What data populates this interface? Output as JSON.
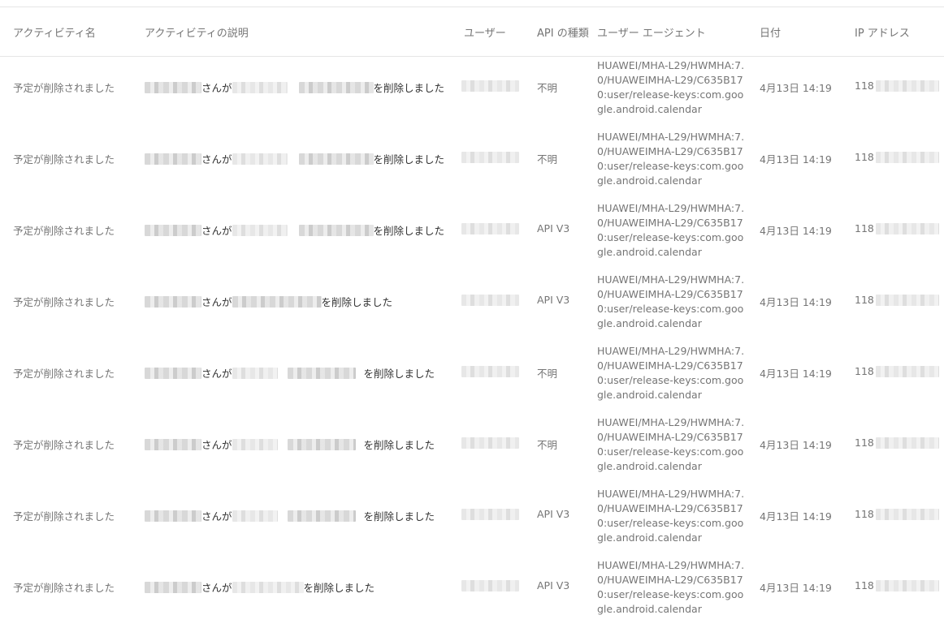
{
  "headers": {
    "activity_name": "アクティビティ名",
    "activity_description": "アクティビティの説明",
    "user": "ユーザー",
    "api_type": "API の種類",
    "user_agent": "ユーザー エージェント",
    "date": "日付",
    "ip_address": "IP アドレス"
  },
  "rows": [
    {
      "activity_name": "予定が削除されました",
      "desc_mid": "さんが",
      "desc_end": "を削除しました",
      "api_type": "不明",
      "user_agent": "HUAWEI/MHA-L29/HWMHA:7.0/HUAWEIMHA-L29/C635B170:user/release-keys:com.google.android.calendar",
      "date": "4月13日 14:19",
      "ip_prefix": "118"
    },
    {
      "activity_name": "予定が削除されました",
      "desc_mid": "さんが",
      "desc_end": "を削除しました",
      "api_type": "不明",
      "user_agent": "HUAWEI/MHA-L29/HWMHA:7.0/HUAWEIMHA-L29/C635B170:user/release-keys:com.google.android.calendar",
      "date": "4月13日 14:19",
      "ip_prefix": "118"
    },
    {
      "activity_name": "予定が削除されました",
      "desc_mid": "さんが",
      "desc_end": "を削除しました",
      "api_type": "API V3",
      "user_agent": "HUAWEI/MHA-L29/HWMHA:7.0/HUAWEIMHA-L29/C635B170:user/release-keys:com.google.android.calendar",
      "date": "4月13日 14:19",
      "ip_prefix": "118"
    },
    {
      "activity_name": "予定が削除されました",
      "desc_mid": "さんが",
      "desc_end": "を削除しました",
      "api_type": "API V3",
      "user_agent": "HUAWEI/MHA-L29/HWMHA:7.0/HUAWEIMHA-L29/C635B170:user/release-keys:com.google.android.calendar",
      "date": "4月13日 14:19",
      "ip_prefix": "118"
    },
    {
      "activity_name": "予定が削除されました",
      "desc_mid": "さんが",
      "desc_end": "を削除しました",
      "api_type": "不明",
      "user_agent": "HUAWEI/MHA-L29/HWMHA:7.0/HUAWEIMHA-L29/C635B170:user/release-keys:com.google.android.calendar",
      "date": "4月13日 14:19",
      "ip_prefix": "118"
    },
    {
      "activity_name": "予定が削除されました",
      "desc_mid": "さんが",
      "desc_end": "を削除しました",
      "api_type": "不明",
      "user_agent": "HUAWEI/MHA-L29/HWMHA:7.0/HUAWEIMHA-L29/C635B170:user/release-keys:com.google.android.calendar",
      "date": "4月13日 14:19",
      "ip_prefix": "118"
    },
    {
      "activity_name": "予定が削除されました",
      "desc_mid": "さんが",
      "desc_end": "を削除しました",
      "api_type": "API V3",
      "user_agent": "HUAWEI/MHA-L29/HWMHA:7.0/HUAWEIMHA-L29/C635B170:user/release-keys:com.google.android.calendar",
      "date": "4月13日 14:19",
      "ip_prefix": "118"
    },
    {
      "activity_name": "予定が削除されました",
      "desc_mid": "さんが",
      "desc_end": "を削除しました",
      "api_type": "API V3",
      "user_agent": "HUAWEI/MHA-L29/HWMHA:7.0/HUAWEIMHA-L29/C635B170:user/release-keys:com.google.android.calendar",
      "date": "4月13日 14:19",
      "ip_prefix": "118"
    }
  ]
}
